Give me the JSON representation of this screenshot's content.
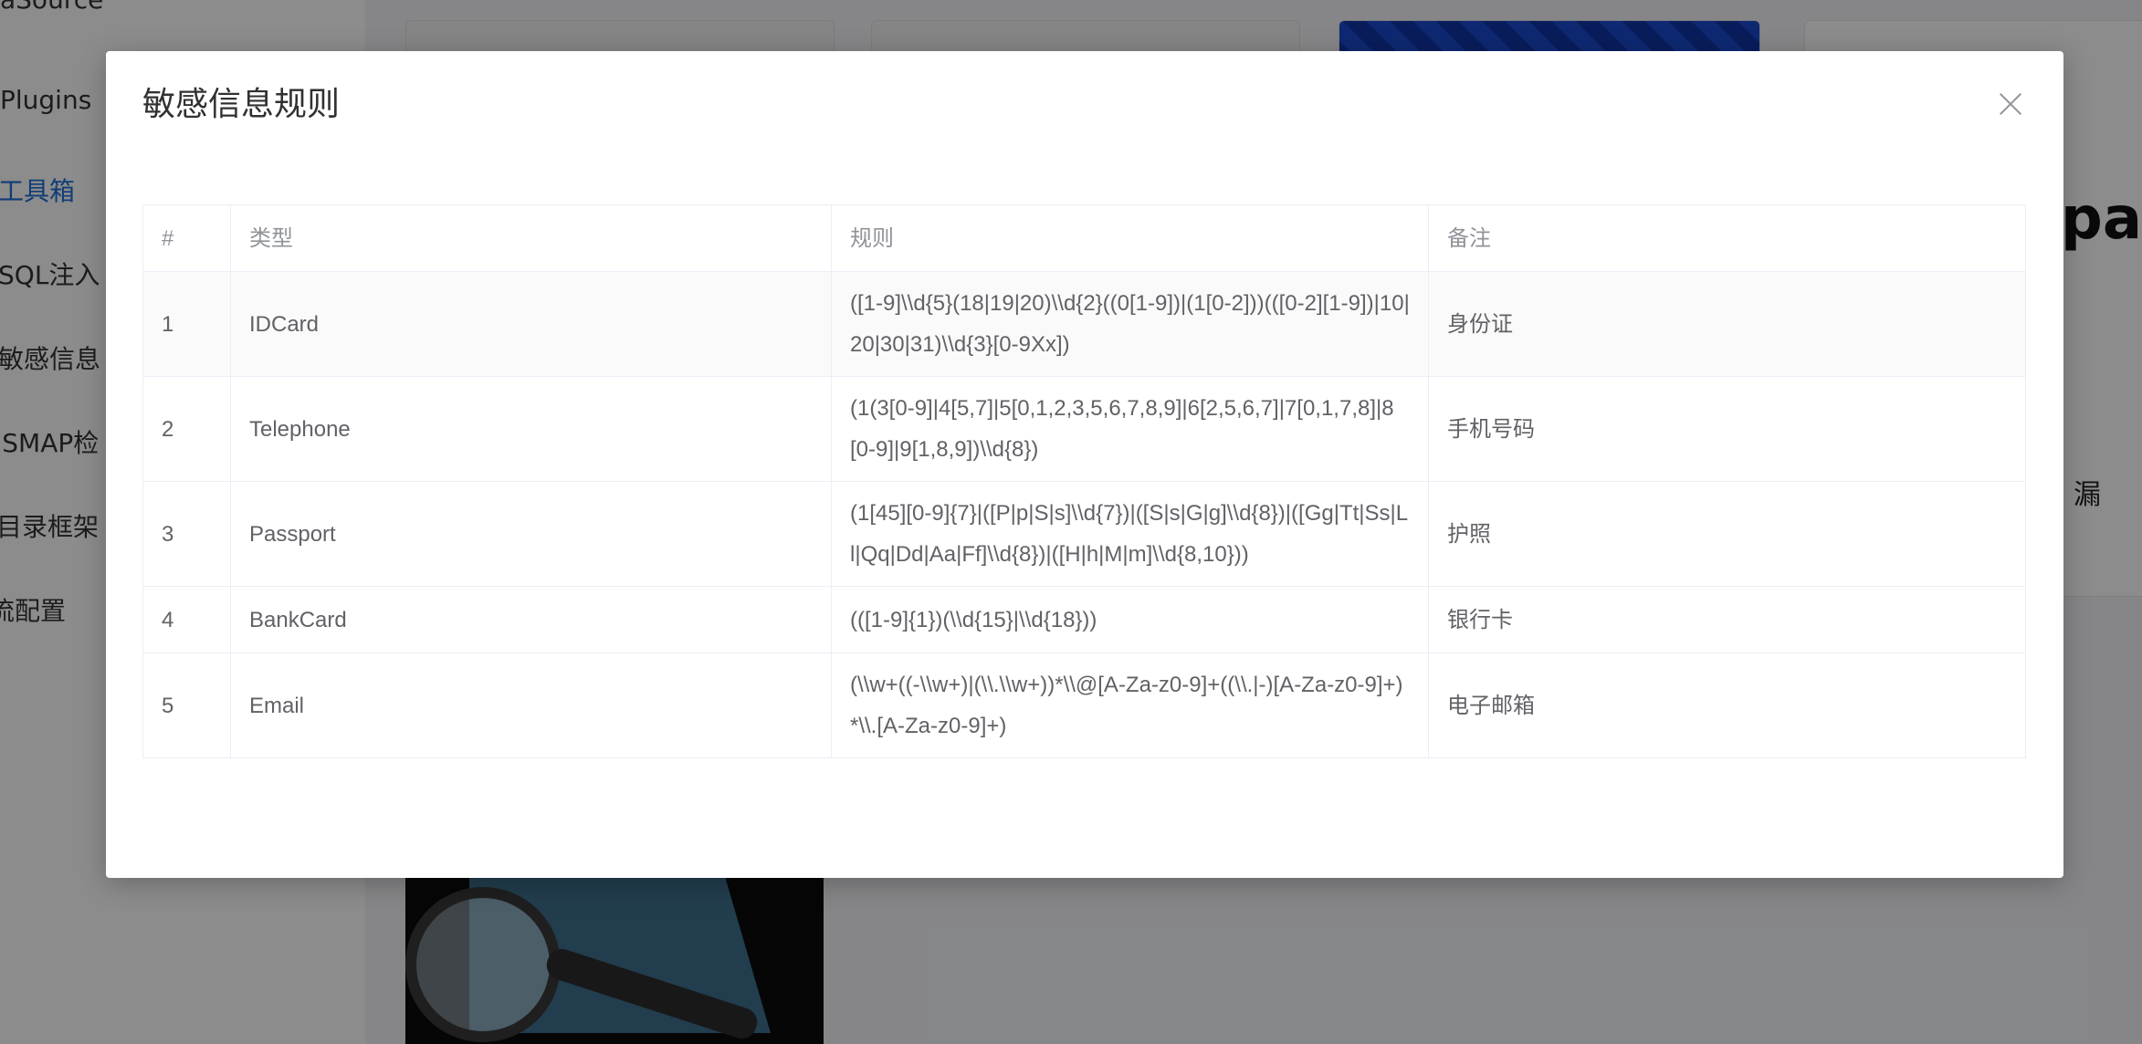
{
  "background": {
    "sidebar": {
      "items": [
        {
          "label": "aSource"
        },
        {
          "label": "Plugins"
        },
        {
          "label": "工具箱"
        },
        {
          "label": "SQL注入"
        },
        {
          "label": "敏感信息"
        },
        {
          "label": "JSMAP检"
        },
        {
          "label": "目录框架"
        },
        {
          "label": "流配置"
        }
      ]
    },
    "right_partial_text": "pac",
    "right_partial_label": "漏"
  },
  "modal": {
    "title": "敏感信息规则",
    "table": {
      "headers": [
        "#",
        "类型",
        "规则",
        "备注"
      ],
      "rows": [
        {
          "index": "1",
          "type": "IDCard",
          "rule": "([1-9]\\\\d{5}(18|19|20)\\\\d{2}((0[1-9])|(1[0-2]))(([0-2][1-9])|10|20|30|31)\\\\d{3}[0-9Xx])",
          "note": "身份证"
        },
        {
          "index": "2",
          "type": "Telephone",
          "rule": "(1(3[0-9]|4[5,7]|5[0,1,2,3,5,6,7,8,9]|6[2,5,6,7]|7[0,1,7,8]|8[0-9]|9[1,8,9])\\\\d{8})",
          "note": "手机号码"
        },
        {
          "index": "3",
          "type": "Passport",
          "rule": "(1[45][0-9]{7}|([P|p|S|s]\\\\d{7})|([S|s|G|g]\\\\d{8})|([Gg|Tt|Ss|Ll|Qq|Dd|Aa|Ff]\\\\d{8})|([H|h|M|m]\\\\d{8,10}))",
          "note": "护照"
        },
        {
          "index": "4",
          "type": "BankCard",
          "rule": "(([1-9]{1})(\\\\d{15}|\\\\d{18}))",
          "note": "银行卡"
        },
        {
          "index": "5",
          "type": "Email",
          "rule": "(\\\\w+((-\\\\w+)|(\\\\.\\\\w+))*\\\\@[A-Za-z0-9]+((\\\\.|-)[A-Za-z0-9]+)*\\\\.[A-Za-z0-9]+)",
          "note": "电子邮箱"
        }
      ]
    }
  }
}
